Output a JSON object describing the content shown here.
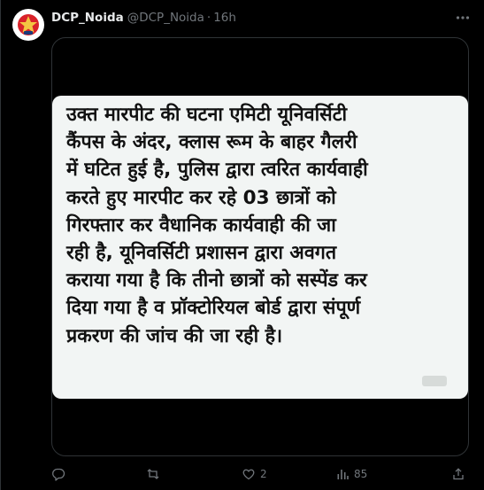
{
  "tweet": {
    "display_name": "DCP_Noida",
    "handle": "@DCP_Noida",
    "separator": "·",
    "time": "16h",
    "media_text_lines": [
      "उक्त मारपीट की घटना एमिटी यूनिवर्सिटी",
      "कैंपस के अंदर, क्लास रूम के बाहर गैलरी",
      "में घटित हुई है, पुलिस द्वारा त्वरित कार्यवाही",
      "करते हुए मारपीट कर रहे 03 छात्रों को",
      "गिरफ्तार कर वैधानिक कार्यवाही की जा",
      "रही है, यूनिवर्सिटी प्रशासन द्वारा अवगत",
      "कराया गया है कि तीनो छात्रों को सस्पेंड कर",
      "दिया गया है व प्रॉक्टोरियल बोर्ड द्वारा संपूर्ण",
      "प्रकरण की जांच की जा रही है।"
    ],
    "stats": {
      "replies": "",
      "reposts": "",
      "likes": "2",
      "views": "85"
    }
  },
  "icons": {
    "more": "more-horizontal-icon",
    "reply": "reply-icon",
    "repost": "repost-icon",
    "like": "heart-icon",
    "views": "views-bar-chart-icon",
    "share": "share-icon"
  },
  "colors": {
    "background": "#000000",
    "text_primary": "#e7e9ea",
    "text_secondary": "#71767b",
    "border": "#2f3336",
    "card_background": "#f2f5f4",
    "card_text": "#111111"
  }
}
